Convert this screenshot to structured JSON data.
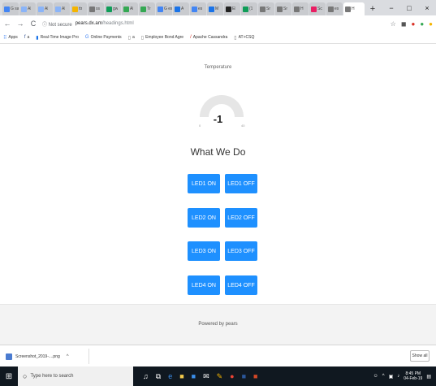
{
  "browser": {
    "tabs": [
      {
        "label": "G sa",
        "color": "#4285f4"
      },
      {
        "label": "Al",
        "color": "#8ab4f8"
      },
      {
        "label": "Al",
        "color": "#8ab4f8"
      },
      {
        "label": "Al",
        "color": "#8ab4f8"
      },
      {
        "label": "ttr",
        "color": "#f4b400"
      },
      {
        "label": "ss",
        "color": "#777777"
      },
      {
        "label": "gw",
        "color": "#0f9d58"
      },
      {
        "label": "Al",
        "color": "#34a853"
      },
      {
        "label": "Tr",
        "color": "#34a853"
      },
      {
        "label": "G es",
        "color": "#4285f4"
      },
      {
        "label": "A",
        "color": "#1a73e8"
      },
      {
        "label": "es",
        "color": "#4285f4"
      },
      {
        "label": "M",
        "color": "#1a73e8"
      },
      {
        "label": "El",
        "color": "#222222"
      },
      {
        "label": "(1",
        "color": "#0f9d58"
      },
      {
        "label": "Sr",
        "color": "#777777"
      },
      {
        "label": "Sr",
        "color": "#777777"
      },
      {
        "label": "H",
        "color": "#777777"
      },
      {
        "label": "Sc",
        "color": "#e91e63"
      },
      {
        "label": "es",
        "color": "#777777"
      },
      {
        "label": "H",
        "color": "#777777"
      }
    ],
    "new_tab_symbol": "+",
    "window_controls": {
      "minimize": "−",
      "maximize": "□",
      "close": "×"
    },
    "nav": {
      "back": "←",
      "forward": "→",
      "reload": "C"
    },
    "address": {
      "security": "ⓘ Not secure",
      "host": "pears.dx.am",
      "path": "/headings.html"
    },
    "bookmarks": [
      {
        "label": "Apps",
        "icon": "apps-grid-icon"
      },
      {
        "label": "a",
        "icon": "facebook-icon"
      },
      {
        "label": "Real-Time Image Pro",
        "icon": "bookmark-icon"
      },
      {
        "label": "Online Payments",
        "icon": "google-icon"
      },
      {
        "label": "a",
        "icon": "page-icon"
      },
      {
        "label": "Employee Bond Agre",
        "icon": "page-icon"
      },
      {
        "label": "Apache Cassandra",
        "icon": "feather-icon"
      },
      {
        "label": "AT+CSQ",
        "icon": "page-icon"
      }
    ]
  },
  "page": {
    "temperature_title": "Temperature",
    "gauge": {
      "value": "-1",
      "min": "0",
      "max": "40",
      "fraction": 0.0
    },
    "section_title": "What We Do",
    "led_rows": [
      {
        "on": "LED1 ON",
        "off": "LED1 OFF"
      },
      {
        "on": "LED2 ON",
        "off": "LED2 OFF"
      },
      {
        "on": "LED3 ON",
        "off": "LED3 OFF"
      },
      {
        "on": "LED4 ON",
        "off": "LED4 OFF"
      }
    ],
    "footer_text": "Powered by pears",
    "colors": {
      "button": "#1e90ff",
      "gauge_track": "#e6e6e6"
    }
  },
  "download_shelf": {
    "file_name": "Screenshot_2019-....png",
    "caret": "^",
    "show_all": "Show all"
  },
  "taskbar": {
    "search_placeholder": "Type here to search",
    "time": "8:45 PM",
    "date": "04-Feb-19"
  }
}
